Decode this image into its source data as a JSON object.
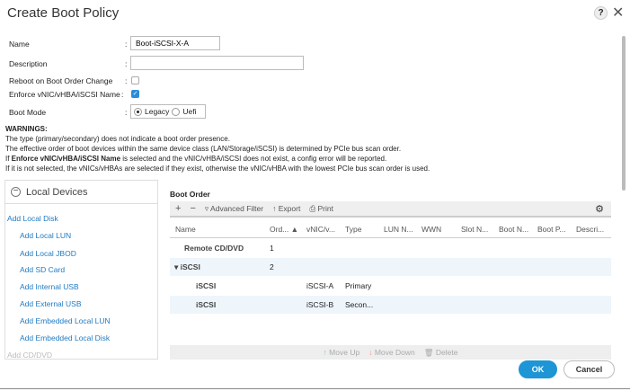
{
  "title": "Create Boot Policy",
  "help": "?",
  "close": "✕",
  "form": {
    "name_label": "Name",
    "name_value": "Boot-iSCSI-X-A",
    "description_label": "Description",
    "description_value": "",
    "reboot_label": "Reboot on Boot Order Change",
    "reboot_checked": false,
    "enforce_label": "Enforce vNIC/vHBA/iSCSI Name",
    "enforce_checked": true,
    "boot_mode_label": "Boot Mode",
    "boot_mode_options": [
      "Legacy",
      "Uefi"
    ],
    "boot_mode_selected": "Legacy",
    "colon": ":"
  },
  "warnings": {
    "title": "WARNINGS:",
    "line1": "The type (primary/secondary) does not indicate a boot order presence.",
    "line2": "The effective order of boot devices within the same device class (LAN/Storage/iSCSI) is determined by PCIe bus scan order.",
    "line3_pre": "If ",
    "line3_bold": "Enforce vNIC/vHBA/iSCSI Name",
    "line3_post": " is selected and the vNIC/vHBA/iSCSI does not exist, a config error will be reported.",
    "line4": "If it is not selected, the vNICs/vHBAs are selected if they exist, otherwise the vNIC/vHBA with the lowest PCIe bus scan order is used."
  },
  "local_devices": {
    "title": "Local Devices",
    "items": [
      "Add Local Disk",
      "Add Local LUN",
      "Add Local JBOD",
      "Add SD Card",
      "Add Internal USB",
      "Add External USB",
      "Add Embedded Local LUN",
      "Add Embedded Local Disk",
      "Add CD/DVD"
    ]
  },
  "boot_order": {
    "title": "Boot Order",
    "toolbar": {
      "add": "+",
      "remove": "−",
      "filter": "Advanced Filter",
      "export": "Export",
      "print": "Print"
    },
    "columns": [
      "Name",
      "Ord...",
      "vNIC/v...",
      "Type",
      "LUN N...",
      "WWN",
      "Slot N...",
      "Boot N...",
      "Boot P...",
      "Descri..."
    ],
    "rows": [
      {
        "name": "Remote CD/DVD",
        "order": "1",
        "vnic": "",
        "type": ""
      },
      {
        "name": "iSCSI",
        "order": "2",
        "vnic": "",
        "type": "",
        "expanded": true
      },
      {
        "name": "iSCSI",
        "order": "",
        "vnic": "iSCSI-A",
        "type": "Primary"
      },
      {
        "name": "iSCSI",
        "order": "",
        "vnic": "iSCSI-B",
        "type": "Secon..."
      }
    ],
    "actions": {
      "move_up": "Move Up",
      "move_down": "Move Down",
      "delete": "Delete"
    }
  },
  "buttons": {
    "ok": "OK",
    "cancel": "Cancel"
  }
}
